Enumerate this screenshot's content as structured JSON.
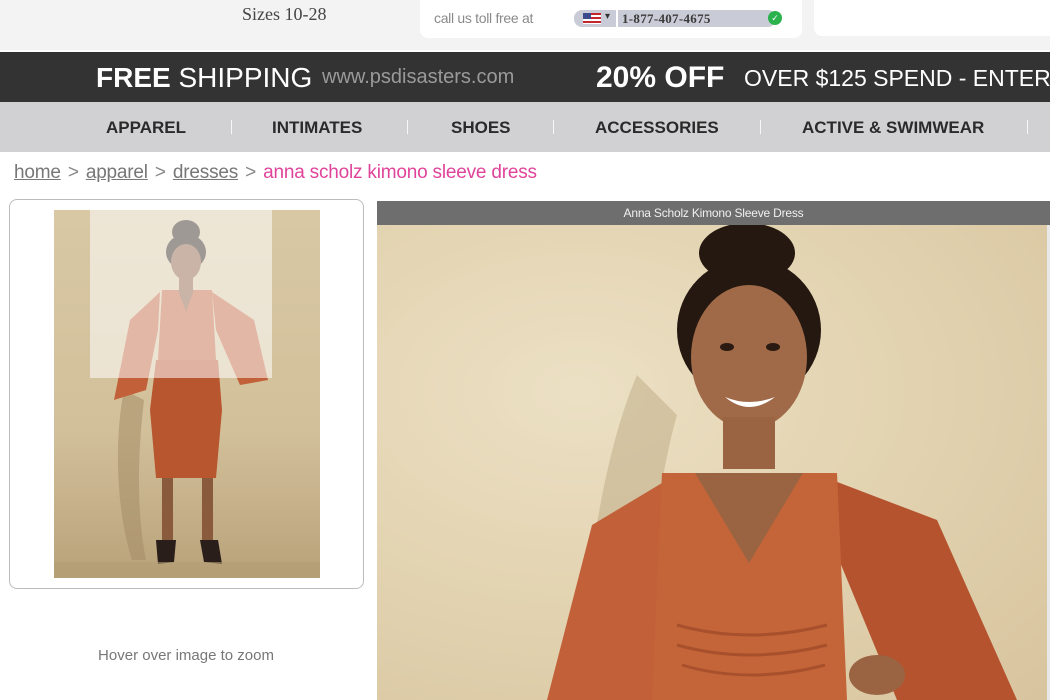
{
  "header": {
    "sizes": "Sizes 10-28",
    "phone_label": "call us toll free at",
    "phone_number": "1-877-407-4675",
    "flag_icon": "us-flag-icon",
    "status_icon": "green-online-icon"
  },
  "promo": {
    "free_bold": "FREE",
    "free_light": "SHIPPING",
    "url": "www.psdisasters.com",
    "discount": "20% OFF",
    "spend": "OVER $125 SPEND - ENTER"
  },
  "nav": {
    "items": [
      {
        "label": "APPAREL"
      },
      {
        "label": "INTIMATES"
      },
      {
        "label": "SHOES"
      },
      {
        "label": "ACCESSORIES"
      },
      {
        "label": "ACTIVE & SWIMWEAR"
      }
    ]
  },
  "breadcrumb": {
    "items": [
      "home",
      "apparel",
      "dresses"
    ],
    "current": "anna scholz kimono sleeve dress",
    "separator": ">"
  },
  "product": {
    "title": "Anna Scholz Kimono Sleeve Dress",
    "zoom_hint": "Hover over image to zoom"
  },
  "colors": {
    "promo_bg": "#333333",
    "nav_bg": "#d1d1d3",
    "breadcrumb_current": "#e0449a",
    "dress": "#c2603a",
    "title_bar": "#6e6e6e"
  }
}
